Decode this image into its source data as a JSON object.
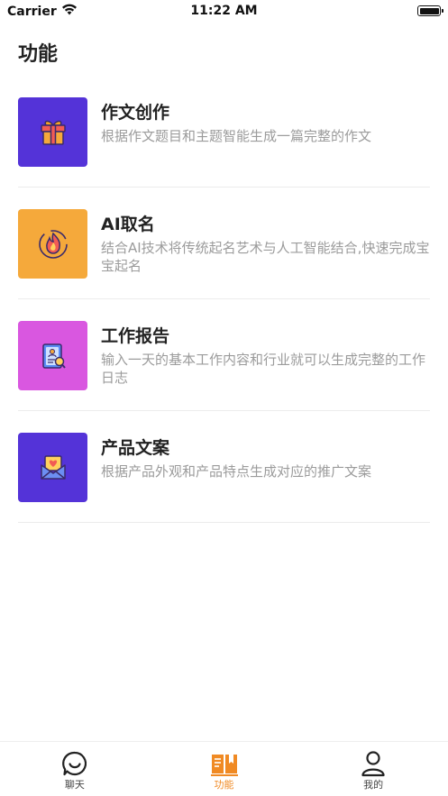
{
  "status_bar": {
    "carrier": "Carrier",
    "time": "11:22 AM",
    "battery_level": 1.0
  },
  "page": {
    "title": "功能"
  },
  "features": [
    {
      "title": "作文创作",
      "description": "根据作文题目和主题智能生成一篇完整的作文",
      "icon": "gift-icon",
      "color": "#5433d8"
    },
    {
      "title": "AI取名",
      "description": "结合AI技术将传统起名艺术与人工智能结合,快速完成宝宝起名",
      "icon": "fire-icon",
      "color": "#f5a93b"
    },
    {
      "title": "工作报告",
      "description": "输入一天的基本工作内容和行业就可以生成完整的工作日志",
      "icon": "report-icon",
      "color": "#d957e0"
    },
    {
      "title": "产品文案",
      "description": "根据产品外观和产品特点生成对应的推广文案",
      "icon": "mail-heart-icon",
      "color": "#5433d8"
    }
  ],
  "tab_bar": {
    "active_color": "#f08a24",
    "tabs": [
      {
        "label": "聊天",
        "icon": "chat-icon",
        "active": false
      },
      {
        "label": "功能",
        "icon": "book-icon",
        "active": true
      },
      {
        "label": "我的",
        "icon": "user-icon",
        "active": false
      }
    ]
  }
}
